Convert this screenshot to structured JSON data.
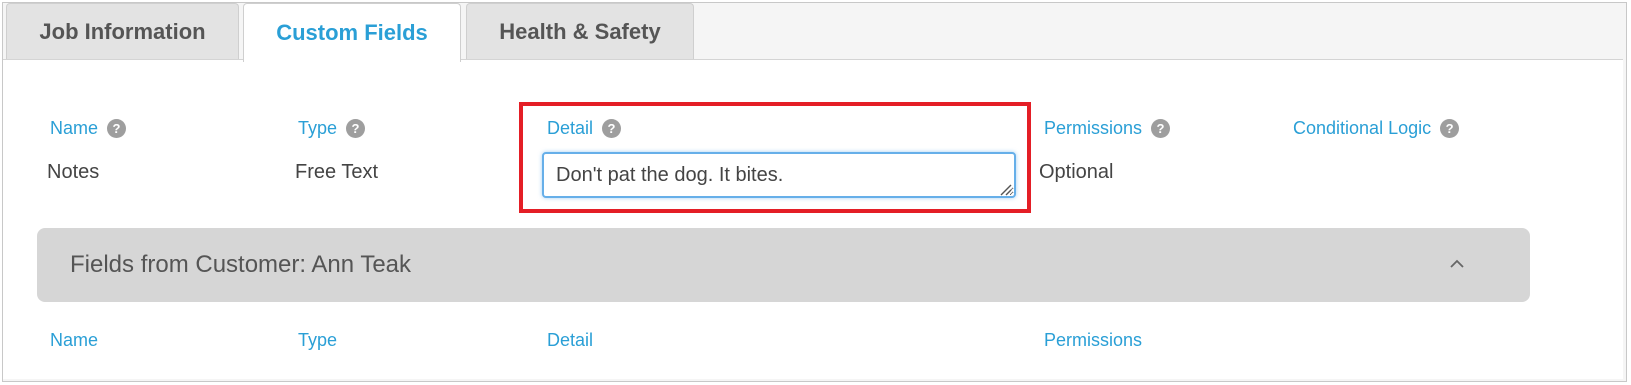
{
  "tabs": [
    {
      "label": "Job Information",
      "active": false
    },
    {
      "label": "Custom Fields",
      "active": true
    },
    {
      "label": "Health & Safety",
      "active": false
    }
  ],
  "job_fields": {
    "headers": {
      "name": "Name",
      "type": "Type",
      "detail": "Detail",
      "permissions": "Permissions",
      "conditional_logic": "Conditional Logic"
    },
    "help_glyph": "?",
    "row": {
      "name": "Notes",
      "type": "Free Text",
      "detail": "Don't pat the dog. It bites.",
      "permissions": "Optional"
    }
  },
  "customer_panel": {
    "title": "Fields from Customer: Ann Teak",
    "chevron_icon": "chevron-up-icon",
    "headers": {
      "name": "Name",
      "type": "Type",
      "detail": "Detail",
      "permissions": "Permissions"
    }
  },
  "colors": {
    "accent": "#2a9fd6",
    "highlight": "#e41e26",
    "panel_bg": "#d6d6d6"
  }
}
